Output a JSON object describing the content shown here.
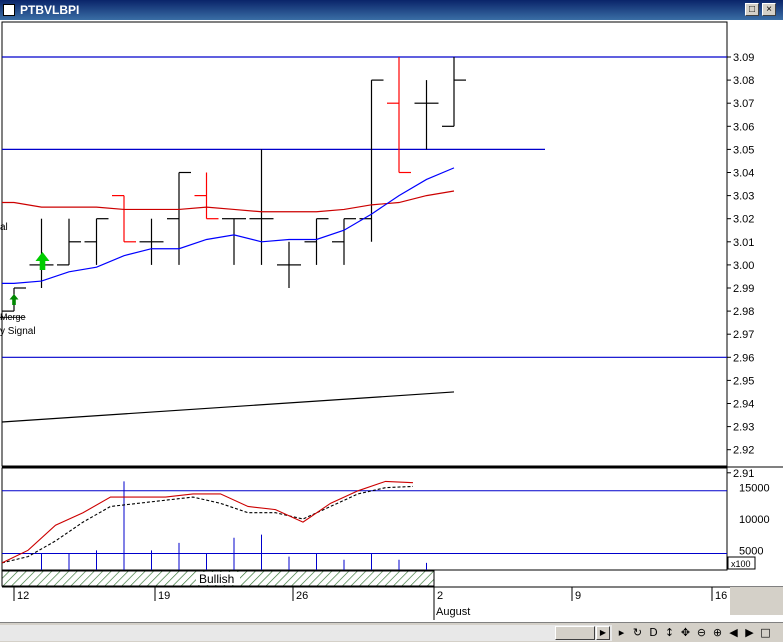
{
  "window": {
    "title": "PTBVLBPI",
    "maximize_icon": "maximize-icon",
    "close_icon": "close-icon",
    "close_glyph": "×"
  },
  "colors": {
    "up_bar": "#000000",
    "down_bar": "#ff0000",
    "fast_ma": "#0000ff",
    "slow_ma": "#cc0000",
    "level_line": "#0000cc",
    "buy_arrow": "#00cc00",
    "bullish_band": "#2f6f2f"
  },
  "chart_data": [
    {
      "type": "ohlc",
      "ylim": [
        2.9,
        3.1
      ],
      "yticks": [
        "3.09",
        "3.08",
        "3.07",
        "3.06",
        "3.05",
        "3.04",
        "3.03",
        "3.02",
        "3.01",
        "3.00",
        "2.99",
        "2.98",
        "2.97",
        "2.96",
        "2.95",
        "2.94",
        "2.93",
        "2.92",
        "2.91"
      ],
      "bars": [
        {
          "date": "Jul 12",
          "o": 2.98,
          "h": 2.99,
          "l": 2.98,
          "c": 2.99
        },
        {
          "date": "Jul 13",
          "o": 3.0,
          "h": 3.02,
          "l": 2.99,
          "c": 3.0
        },
        {
          "date": "Jul 14",
          "o": 3.0,
          "h": 3.02,
          "l": 3.0,
          "c": 3.01
        },
        {
          "date": "Jul 15",
          "o": 3.01,
          "h": 3.02,
          "l": 3.0,
          "c": 3.02
        },
        {
          "date": "Jul 16",
          "o": 3.03,
          "h": 3.03,
          "l": 3.01,
          "c": 3.01
        },
        {
          "date": "Jul 17",
          "o": 3.01,
          "h": 3.02,
          "l": 3.0,
          "c": 3.01
        },
        {
          "date": "Jul 18",
          "o": 3.02,
          "h": 3.04,
          "l": 3.0,
          "c": 3.04
        },
        {
          "date": "Jul 19",
          "o": 3.03,
          "h": 3.04,
          "l": 3.02,
          "c": 3.02
        },
        {
          "date": "Jul 20",
          "o": 3.02,
          "h": 3.02,
          "l": 3.0,
          "c": 3.02
        },
        {
          "date": "Jul 21",
          "o": 3.02,
          "h": 3.05,
          "l": 3.0,
          "c": 3.02
        },
        {
          "date": "Jul 22",
          "o": 3.0,
          "h": 3.01,
          "l": 2.99,
          "c": 3.0
        },
        {
          "date": "Jul 23",
          "o": 3.01,
          "h": 3.02,
          "l": 3.0,
          "c": 3.02
        },
        {
          "date": "Jul 24",
          "o": 3.01,
          "h": 3.02,
          "l": 3.0,
          "c": 3.02
        },
        {
          "date": "Jul 26",
          "o": 3.02,
          "h": 3.08,
          "l": 3.01,
          "c": 3.08
        },
        {
          "date": "Jul 27",
          "o": 3.07,
          "h": 3.09,
          "l": 3.04,
          "c": 3.04
        },
        {
          "date": "Jul 28",
          "o": 3.07,
          "h": 3.08,
          "l": 3.05,
          "c": 3.07
        },
        {
          "date": "Jul 29",
          "o": 3.06,
          "h": 3.09,
          "l": 3.06,
          "c": 3.08
        }
      ],
      "fast_ma": [
        2.992,
        2.993,
        2.997,
        2.999,
        3.004,
        3.007,
        3.007,
        3.011,
        3.013,
        3.01,
        3.011,
        3.011,
        3.015,
        3.022,
        3.03,
        3.037,
        3.042
      ],
      "slow_ma": [
        3.027,
        3.025,
        3.025,
        3.025,
        3.024,
        3.024,
        3.024,
        3.025,
        3.024,
        3.023,
        3.023,
        3.023,
        3.024,
        3.026,
        3.027,
        3.03,
        3.032
      ],
      "long_line": {
        "start": 2.932,
        "end": 2.945
      },
      "hlines": [
        3.09,
        3.05,
        2.96
      ],
      "annotations": {
        "signal_top": "al",
        "signal_bottom": "y Signal",
        "marker": "Merge"
      }
    },
    {
      "type": "line",
      "unit_label": "x100",
      "yticks": [
        "15000",
        "10000",
        "5000"
      ],
      "ylim": [
        2500,
        17500
      ],
      "hlines": [
        14500,
        4500
      ],
      "line_solid": [
        3000,
        5000,
        9000,
        11000,
        13500,
        13500,
        13500,
        14000,
        14000,
        12000,
        11500,
        9500,
        12500,
        14500,
        16000,
        15800
      ],
      "line_dashed": [
        3000,
        4000,
        6500,
        9500,
        12000,
        12500,
        13000,
        13500,
        12500,
        11000,
        11000,
        10000,
        12000,
        14000,
        15000,
        15200
      ],
      "volume": [
        0,
        4500,
        4500,
        5000,
        16000,
        5000,
        6200,
        4500,
        7000,
        7500,
        4000,
        4500,
        3500,
        4500,
        3500,
        3000
      ],
      "band_label": "Bullish"
    }
  ],
  "xaxis": {
    "ticks": [
      "12",
      "19",
      "26",
      "2",
      "9",
      "16"
    ],
    "month_label": "August"
  },
  "toolbar": {
    "items": [
      {
        "name": "scroll-right-icon",
        "glyph": "▸"
      },
      {
        "name": "refresh-icon",
        "glyph": "↻"
      },
      {
        "name": "period-d-icon",
        "glyph": "D"
      },
      {
        "name": "vertical-move-icon",
        "glyph": "↕"
      },
      {
        "name": "move-icon",
        "glyph": "✥"
      },
      {
        "name": "zoom-out-icon",
        "glyph": "⊖"
      },
      {
        "name": "zoom-in-icon",
        "glyph": "⊕"
      },
      {
        "name": "prev-icon",
        "glyph": "◀"
      },
      {
        "name": "next-icon",
        "glyph": "▶"
      },
      {
        "name": "window-icon",
        "glyph": "□"
      }
    ]
  }
}
